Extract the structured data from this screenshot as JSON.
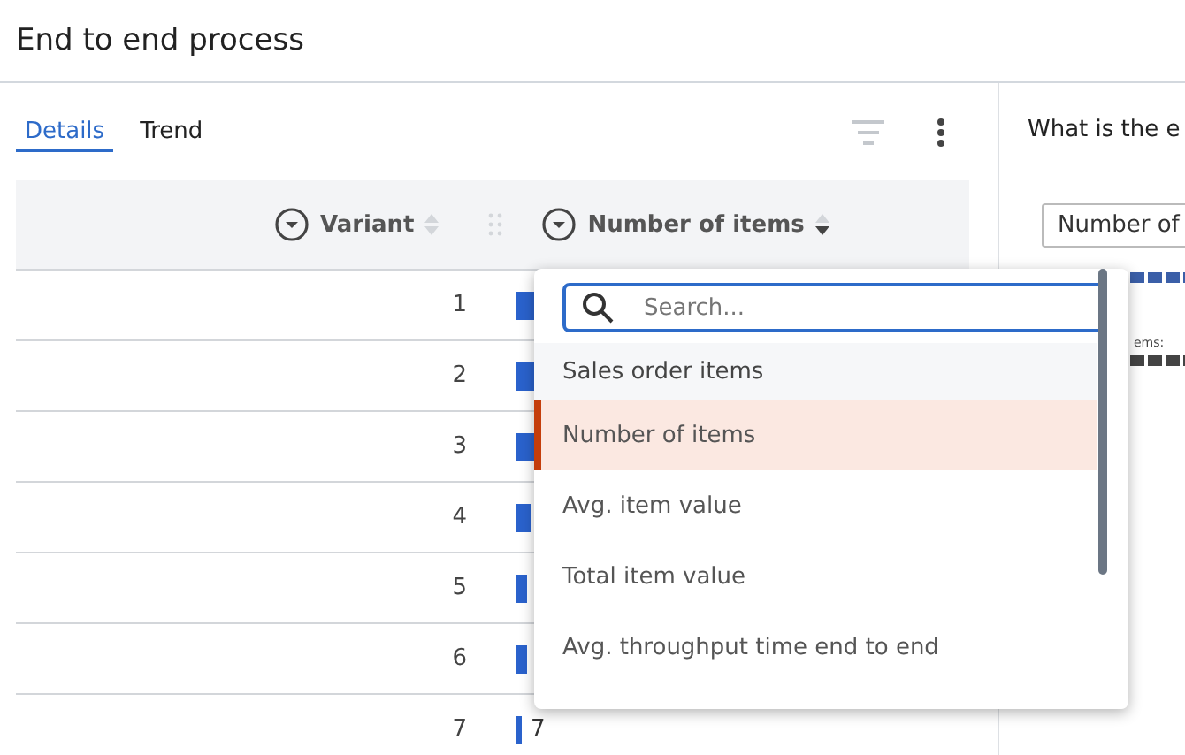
{
  "title": "End to end process",
  "tabs": [
    {
      "label": "Details",
      "selected": true
    },
    {
      "label": "Trend",
      "selected": false
    }
  ],
  "table": {
    "columns": [
      "Variant",
      "Number of items"
    ],
    "rows": [
      {
        "variant": "1"
      },
      {
        "variant": "2"
      },
      {
        "variant": "3"
      },
      {
        "variant": "4"
      },
      {
        "variant": "5"
      },
      {
        "variant": "6"
      },
      {
        "variant": "7",
        "value": "7"
      }
    ]
  },
  "dropdown": {
    "search": {
      "placeholder": "Search..."
    },
    "group": "Sales order items",
    "items": [
      {
        "label": "Number of items",
        "selected": true
      },
      {
        "label": "Avg. item value",
        "selected": false
      },
      {
        "label": "Total item value",
        "selected": false
      },
      {
        "label": "Avg. throughput time end to end",
        "selected": false
      }
    ]
  },
  "right_panel": {
    "question": "What is the e",
    "select": "Number of",
    "legend": "ems:"
  }
}
